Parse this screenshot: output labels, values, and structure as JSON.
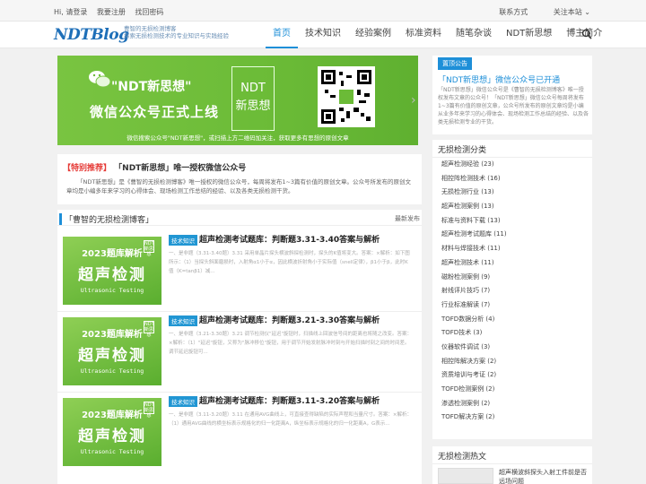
{
  "topbar": {
    "greeting": "Hi, 请登录",
    "register": "我要注册",
    "forgot": "找回密码",
    "contact": "联系方式",
    "follow": "关注本站 ⌄"
  },
  "header": {
    "logo": "NDTBlog",
    "logo_sub_1": "曹智的无损检测博客",
    "logo_sub_2": "探索无损检测技术的专业知识与实践经验",
    "nav": [
      "首页",
      "技术知识",
      "经验案例",
      "标准资料",
      "随笔杂谈",
      "NDT新思想",
      "博主简介"
    ]
  },
  "banner": {
    "title_quote": "\"NDT新思想\"",
    "title_main": "微信公众号正式上线",
    "ndt_line1": "NDT",
    "ndt_line2": "新思想",
    "caption": "微信搜索公众号\"NDT新思想\"，或扫描上方二维码加关注，获取更多有思想的原创文章"
  },
  "notice": {
    "tag": "置顶公告",
    "title": "「NDT新思想」微信公众号已开通",
    "body": "「NDT新思想」微信公众号是《曹智的无损检测博客》唯一授权发布文章的公众号！「NDT新思想」微信公众号每周将发布1~3篇有价值的原创文章，公众号所发布的原创文章均是小编从业多年来学习的心得体会、现场检测工作总结的经验、以及各类无损检测专业的干货。"
  },
  "recommend": {
    "tag": "【特别推荐】",
    "title": "「NDT新思想」唯一授权微信公众号",
    "body": "「NDT新思想」是《曹智的无损检测博客》唯一授权的微信公众号，每周将发布1~3篇有价值的原创文章。公众号所发布的原创文章均是小编多年来学习的心得体会、现场检测工作总结的经验、以及各类无损检测干货。"
  },
  "list": {
    "title": "「曹智的无损检测博客」",
    "more": "最新发布",
    "thumb": {
      "year": "2023题库解析",
      "big": "超声检测",
      "en": "Ultrasonic Testing",
      "logo": "NDT 新思想"
    },
    "articles": [
      {
        "badge": "技术知识",
        "title": "超声检测考试题库：判断题3.31-3.40答案与解析",
        "excerpt": "一、是非题（3.31-3.40题）3.31 采用单晶片探头横波斜探检测时，探头的K值将变大。答案：×解析：如下图所示：（1）当探头斜面磨损时，入射角α1小于α，因此横波折射角小于实际值（snell定律），β1小于β，此时K值（K=tanβ1）减..."
      },
      {
        "badge": "技术知识",
        "title": "超声检测考试题库：判断题3.21-3.30答案与解析",
        "excerpt": "一、是非题（3.21-3.30题）3.21 调节检测仪\"延迟\"旋钮时，扫描线上回波信号间的距离也将随之改变。答案：×解析：（1）\"延迟\"旋钮，又称为\"脉冲移位\"旋钮，用于调节开始发射脉冲时刻与开始扫描时刻之间的时间差。调节延迟旋钮可..."
      },
      {
        "badge": "技术知识",
        "title": "超声检测考试题库：判断题3.11-3.20答案与解析",
        "excerpt": "一、是非题（3.11-3.20题）3.11 在通用AVG曲线上，可直接查得缺陷的实际声程和当量尺寸。答案：×解析：（1）通用AVG曲线的横坐标表示规格化的归一化距离A，纵坐标表示规格化的归一化距离A，G表示..."
      }
    ]
  },
  "categories": {
    "title": "无损检测分类",
    "items": [
      "超声检测经验 (23)",
      "相控阵检测技术 (16)",
      "无损检测行业 (13)",
      "超声检测案例 (13)",
      "标准与资料下载 (13)",
      "超声检测考试题库 (11)",
      "材料与焊接技术 (11)",
      "超声检测技术 (11)",
      "磁粉检测案例 (9)",
      "射线评片技巧 (7)",
      "行业标准解读 (7)",
      "TOFD数据分析 (4)",
      "TOFD技术 (3)",
      "仪器软件调试 (3)",
      "相控阵解决方案 (2)",
      "资质培训与考证 (2)",
      "TOFD检测案例 (2)",
      "渗透检测案例 (2)",
      "TOFD解决方案 (2)"
    ]
  },
  "hot": {
    "title": "无损检测热文",
    "first": "超声横波斜探头入射工件前是否远场问题"
  },
  "colors": {
    "accent": "#1e8fd8",
    "green": "#6bbb37",
    "red": "#e53935"
  }
}
